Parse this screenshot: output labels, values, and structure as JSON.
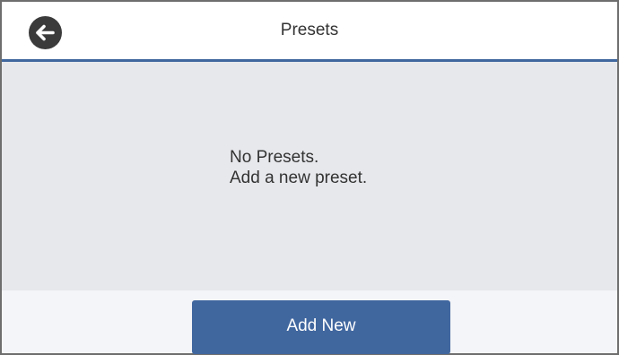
{
  "header": {
    "title": "Presets",
    "back_icon": "arrow-left-icon"
  },
  "main": {
    "message_line1": "No Presets.",
    "message_line2": "Add a new preset."
  },
  "footer": {
    "add_label": "Add New"
  },
  "colors": {
    "accent": "#41679f",
    "content_bg": "#e7e8ec",
    "header_bg": "#ffffff",
    "back_button": "#3b3b3b",
    "text": "#333333"
  }
}
